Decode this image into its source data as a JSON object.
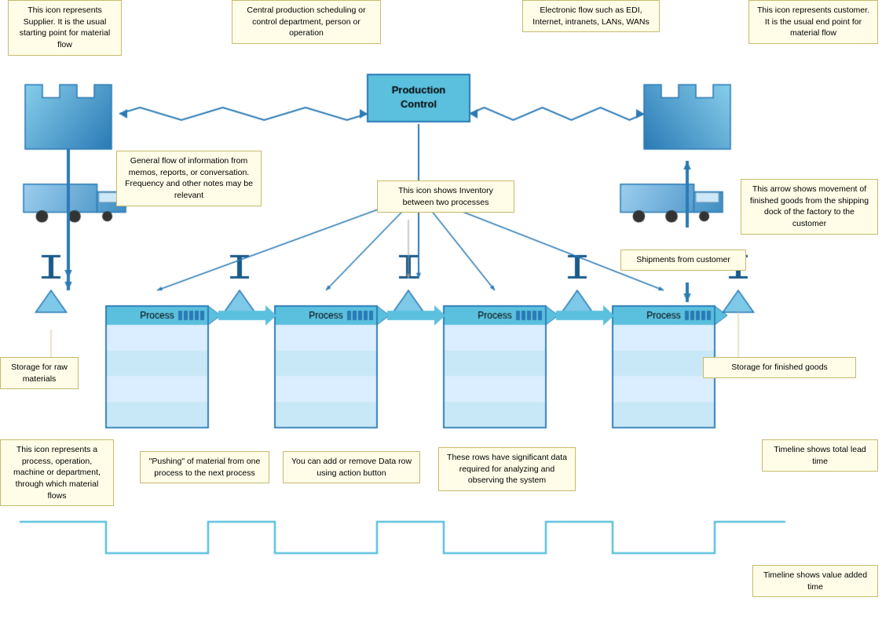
{
  "callouts": {
    "supplier": "This icon represents Supplier. It is the usual starting point for material flow",
    "customer": "This icon represents customer. It is the usual end point for material flow",
    "prod_control": "Central production scheduling or control department, person or operation",
    "electronic": "Electronic flow such as EDI, Internet, intranets, LANs, WANs",
    "info_flow": "General flow of information from memos, reports, or conversation. Frequency and other notes may be relevant",
    "inventory": "This icon shows Inventory between two processes",
    "shipments": "Shipments from customer",
    "finished_goods": "Storage for finished goods",
    "process_icon": "This icon represents a process, operation, machine or department, through which material flows",
    "pushing": "\"Pushing\" of material from one process to the next process",
    "data_rows": "You can add or remove Data row using action button",
    "significant_data": "These rows have significant data required for analyzing and observing the system",
    "timeline_lead": "Timeline shows total lead time",
    "timeline_value": "Timeline shows value added time",
    "storage_raw": "Storage for raw materials"
  },
  "production_control": "Production\nControl",
  "process_label": "Process",
  "colors": {
    "blue_main": "#5bc0de",
    "blue_dark": "#2a7ab5",
    "blue_border": "#5a9ac5",
    "callout_bg": "#fffde7",
    "callout_border": "#c8b96e"
  }
}
